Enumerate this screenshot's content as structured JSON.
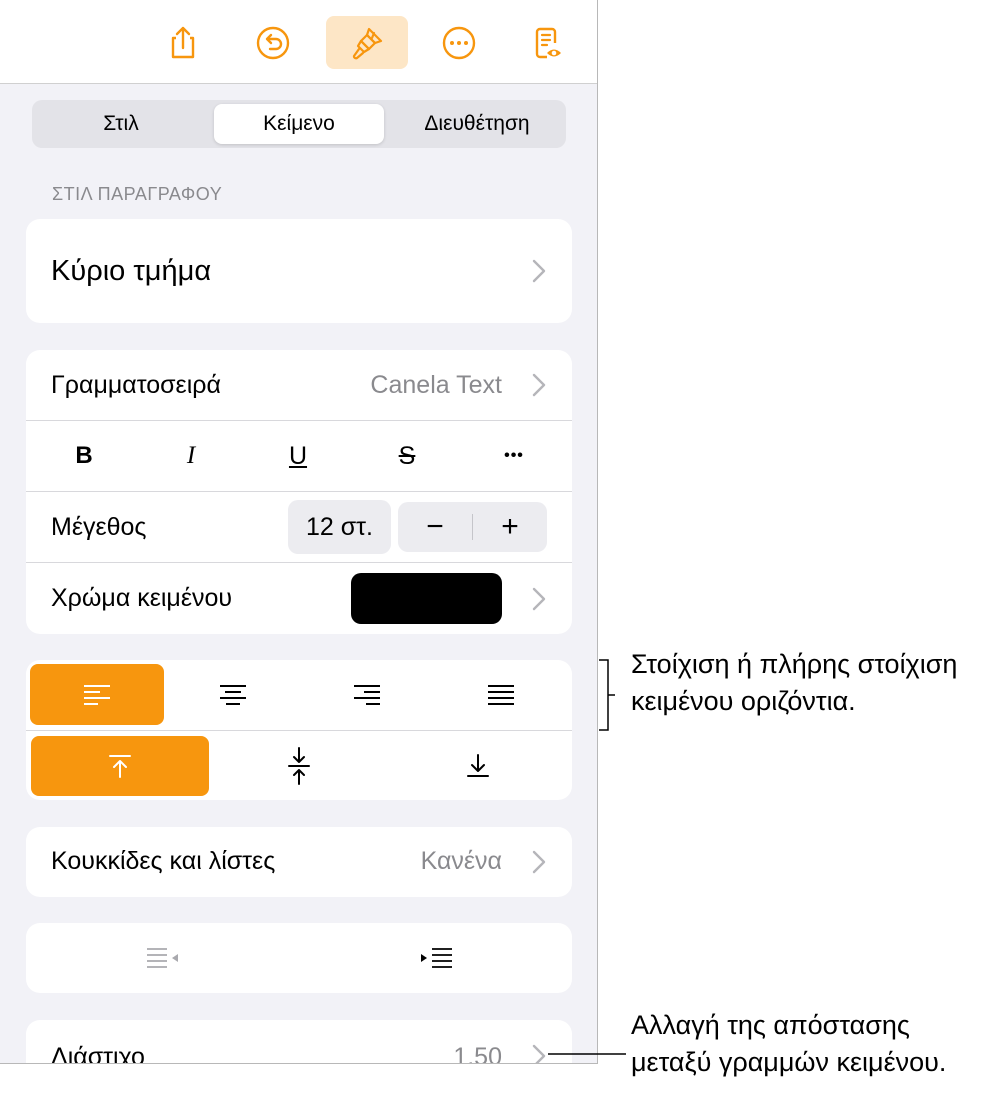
{
  "toolbar": {
    "buttons": [
      {
        "icon": "share-icon"
      },
      {
        "icon": "undo-icon"
      },
      {
        "icon": "format-brush-icon",
        "active": true
      },
      {
        "icon": "more-icon"
      },
      {
        "icon": "reading-view-icon"
      }
    ],
    "accent": "#f7960e",
    "active_bg": "#fde6c6"
  },
  "tabs": [
    {
      "label": "Στιλ",
      "selected": false
    },
    {
      "label": "Κείμενο",
      "selected": true
    },
    {
      "label": "Διευθέτηση",
      "selected": false
    }
  ],
  "paragraph_style": {
    "section_label": "ΣΤΙΛ ΠΑΡΑΓΡΑΦΟΥ",
    "value": "Κύριο τμήμα"
  },
  "font": {
    "label": "Γραμματοσειρά",
    "value": "Canela Text",
    "format_buttons": [
      {
        "glyph": "B",
        "name": "bold"
      },
      {
        "glyph": "I",
        "name": "italic"
      },
      {
        "glyph": "U",
        "name": "underline"
      },
      {
        "glyph": "S",
        "name": "strikethrough"
      },
      {
        "glyph": "•••",
        "name": "more-formatting"
      }
    ],
    "size_label": "Μέγεθος",
    "size_value": "12 στ.",
    "decrease": "−",
    "increase": "+",
    "color_label": "Χρώμα κειμένου",
    "color_value": "#000000"
  },
  "alignment": {
    "horizontal": [
      {
        "name": "align-left",
        "selected": true
      },
      {
        "name": "align-center",
        "selected": false
      },
      {
        "name": "align-right",
        "selected": false
      },
      {
        "name": "align-justify",
        "selected": false
      }
    ],
    "vertical": [
      {
        "name": "align-top",
        "selected": true
      },
      {
        "name": "align-middle",
        "selected": false
      },
      {
        "name": "align-bottom",
        "selected": false
      }
    ]
  },
  "bullets": {
    "label": "Κουκκίδες και λίστες",
    "value": "Κανένα"
  },
  "indent": {
    "decrease": "decrease-indent",
    "increase": "increase-indent"
  },
  "line_spacing": {
    "label": "Διάστιχο",
    "value": "1,50"
  },
  "callouts": {
    "alignment": [
      "Στοίχιση ή πλήρης στοίχιση",
      "κειμένου οριζόντια."
    ],
    "spacing": [
      "Αλλαγή της απόστασης",
      "μεταξύ γραμμών κειμένου."
    ]
  }
}
